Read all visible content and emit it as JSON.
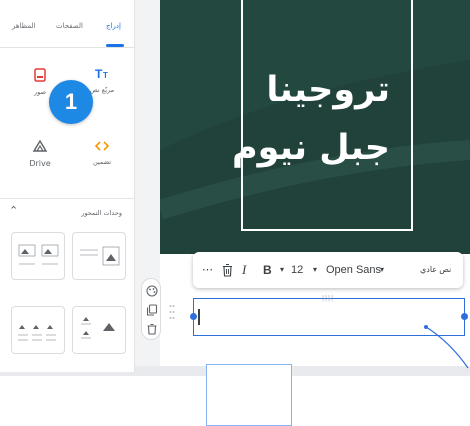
{
  "panel": {
    "tabs": {
      "active": "إدراج",
      "slides": "الصفحات",
      "themes": "المظاهر"
    },
    "tiles": {
      "text_box": "مربّع نص",
      "images": "صور",
      "embed": "تضمين",
      "drive": "Drive"
    },
    "badge_number": "1",
    "layouts_section_title": "وحدات التمحور"
  },
  "slide": {
    "title_line1": "تروجينا",
    "title_line2": "جبل نيوم",
    "background": "#23483f"
  },
  "toolbar": {
    "more": "⋯",
    "bold": "B",
    "italic": "I",
    "font_size": "12",
    "font_family": "Open Sans",
    "style": "نص عادي"
  },
  "textbox": {
    "value": "",
    "top_marker": "||||"
  },
  "colors": {
    "accent": "#1a73e8",
    "badge": "#1e88e5",
    "selection": "#2f6fdc"
  }
}
